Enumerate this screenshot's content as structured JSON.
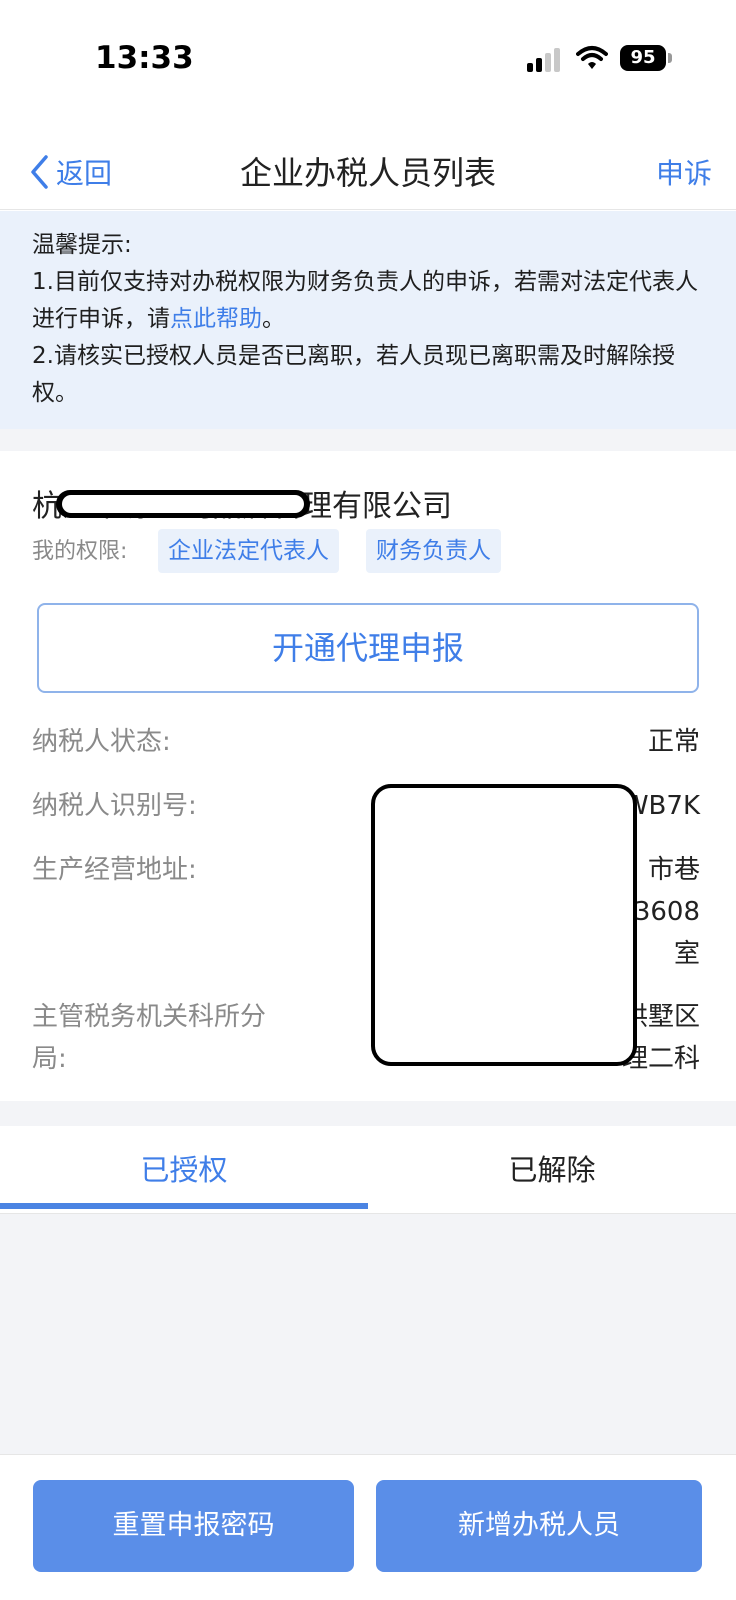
{
  "status_bar": {
    "time": "13:33",
    "battery": "95",
    "icons": [
      "signal-icon",
      "wifi-icon",
      "battery-icon"
    ]
  },
  "nav": {
    "back_label": "返回",
    "title": "企业办税人员列表",
    "right_label": "申诉",
    "back_icon": "chevron-left-icon"
  },
  "tips": {
    "heading": "温馨提示:",
    "line1_prefix": "1.目前仅支持对办税权限为财务负责人的申诉，若需对法定代表人进行申诉，请",
    "line1_link": "点此帮助",
    "line1_suffix": "。",
    "line2": "2.请核实已授权人员是否已离职，若人员现已离职需及时解除授权。"
  },
  "company": {
    "name": "杭州某源企创品牌管理有限公司",
    "permission_label": "我的权限:",
    "permission_tags": [
      "企业法定代表人",
      "财务负责人"
    ],
    "open_button_label": "开通代理申报"
  },
  "info": {
    "status_label": "纳税人状态:",
    "status_value": "正常",
    "id_label": "纳税人识别号:",
    "id_value": "9                    WB7K",
    "address_label": "生产经营地址:",
    "address_value_lines": [
      "浙                    市巷",
      "街道                  3608",
      "室"
    ],
    "bureau_label_lines": [
      "主管税务机关科所分",
      "局:"
    ],
    "bureau_value_lines": [
      "国                    拱墅区",
      "                  理二科"
    ]
  },
  "tabs": {
    "authorized": "已授权",
    "removed": "已解除"
  },
  "actions": {
    "reset_password": "重置申报密码",
    "add_staff": "新增办税人员"
  },
  "colors": {
    "accent": "#3f7ee8",
    "tip_background": "#eaf1fb",
    "button_fill": "#5a8ee8",
    "page_gap": "#f3f4f7"
  }
}
